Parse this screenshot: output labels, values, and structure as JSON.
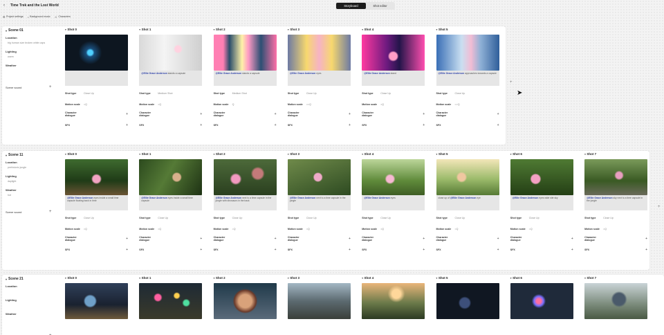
{
  "header": {
    "back_icon": "chevron-left-icon",
    "project_title": "Time Trek and the Lost World",
    "view_tabs": [
      {
        "label": "Storyboard",
        "active": true
      },
      {
        "label": "Shot editor",
        "active": false
      }
    ]
  },
  "toolbar": {
    "items": [
      {
        "label": "Project settings",
        "icon": "gear-icon"
      },
      {
        "label": "Background music",
        "icon": "music-icon"
      },
      {
        "label": "Characters",
        "icon": "people-icon"
      }
    ]
  },
  "labels": {
    "location": "Location",
    "lighting": "Lighting",
    "weather": "Weather",
    "scene_sound": "Scene sound",
    "shot_type": "Shot type",
    "motion_scale": "Motion scale",
    "character_dialogue": "Character dialogue",
    "sfx": "SFX"
  },
  "scenes": [
    {
      "title": "Scene 01",
      "location": "big human size broken white caps",
      "lighting": "warm",
      "weather": "",
      "shots": [
        {
          "name": "Shot 0",
          "desc_char": "",
          "desc_text": "",
          "shot_type": "Close Up",
          "motion": "=Q"
        },
        {
          "name": "Shot 1",
          "desc_char": "@Ellie Grace Anderson",
          "desc_text": "stands a capsule",
          "shot_type": "Medium Shot",
          "motion": "=Q"
        },
        {
          "name": "Shot 2",
          "desc_char": "@Ellie Grace Anderson",
          "desc_text": "stands a capsule",
          "shot_type": "Medium Shot",
          "motion": "Q"
        },
        {
          "name": "Shot 3",
          "desc_char": "@Ellie Grace Anderson",
          "desc_text": "eyes",
          "shot_type": "Close Up",
          "motion": "==Q"
        },
        {
          "name": "Shot 4",
          "desc_char": "@Ellie Grace Anderson",
          "desc_text": "stand",
          "shot_type": "Close Up",
          "motion": "=Q"
        },
        {
          "name": "Shot 5",
          "desc_char": "@Ellie Grace Anderson",
          "desc_text": "approaches towards a capsule",
          "shot_type": "Close Up",
          "motion": "==Q"
        }
      ]
    },
    {
      "title": "Scene 11",
      "location": "prehistoric jungle",
      "lighting": "daylight",
      "weather": "hot",
      "shots": [
        {
          "name": "Shot 0",
          "desc_char": "@Ellie Grace Anderson",
          "desc_text": "eyes inside a small time capsule floating back in time",
          "shot_type": "Close Up",
          "motion": "=Q"
        },
        {
          "name": "Shot 1",
          "desc_char": "@Ellie Grace Anderson",
          "desc_text": "eyes inside a small time capsule",
          "shot_type": "Close Up",
          "motion": "=Q"
        },
        {
          "name": "Shot 2",
          "desc_char": "@Ellie Grace Anderson",
          "desc_text": "next to a time capsule in the jungle with dinosaurs in the back",
          "shot_type": "Close Up",
          "motion": "=Q"
        },
        {
          "name": "Shot 3",
          "desc_char": "@Ellie Grace Anderson",
          "desc_text": "next to a time capsule in the jungle",
          "shot_type": "Close Up",
          "motion": "=Q"
        },
        {
          "name": "Shot 4",
          "desc_char": "@Ellie Grace Anderson",
          "desc_text": "eyes",
          "shot_type": "Close Up",
          "motion": "=Q"
        },
        {
          "name": "Shot 5",
          "desc_char": "@Ellie Grace Anderson",
          "desc_text": "eye",
          "desc_prefix": "close up of",
          "shot_type": "Close Up",
          "motion": "=Q"
        },
        {
          "name": "Shot 6",
          "desc_char": "@Ellie Grace Anderson",
          "desc_text": "eyes wide site sky",
          "shot_type": "Close Up",
          "motion": "=Q"
        },
        {
          "name": "Shot 7",
          "desc_char": "@Ellie Grace Anderson",
          "desc_text": "sky next to a time capsule in the jungle",
          "shot_type": "Close Up",
          "motion": "=Q"
        }
      ]
    },
    {
      "title": "Scene 21",
      "location": "",
      "lighting": "",
      "weather": "",
      "shots": [
        {
          "name": "Shot 0"
        },
        {
          "name": "Shot 1"
        },
        {
          "name": "Shot 2"
        },
        {
          "name": "Shot 3"
        },
        {
          "name": "Shot 4"
        },
        {
          "name": "Shot 5"
        },
        {
          "name": "Shot 6"
        },
        {
          "name": "Shot 7"
        }
      ]
    }
  ],
  "image_styles": [
    [
      "img-dark-scifi",
      "img-white-corr",
      "img-pink-hall",
      "img-yellow-hall",
      "img-neon",
      "img-blue-hall"
    ],
    [
      "img-jungle",
      "img-jungle2",
      "img-dino",
      "img-jungle3",
      "img-meadow",
      "img-sunfield",
      "img-jungle4",
      "img-jungle5"
    ],
    [
      "img-lizard",
      "img-bokeh",
      "img-face",
      "img-rocks",
      "img-sunset",
      "img-orb",
      "img-orb2",
      "img-lizard2"
    ]
  ]
}
